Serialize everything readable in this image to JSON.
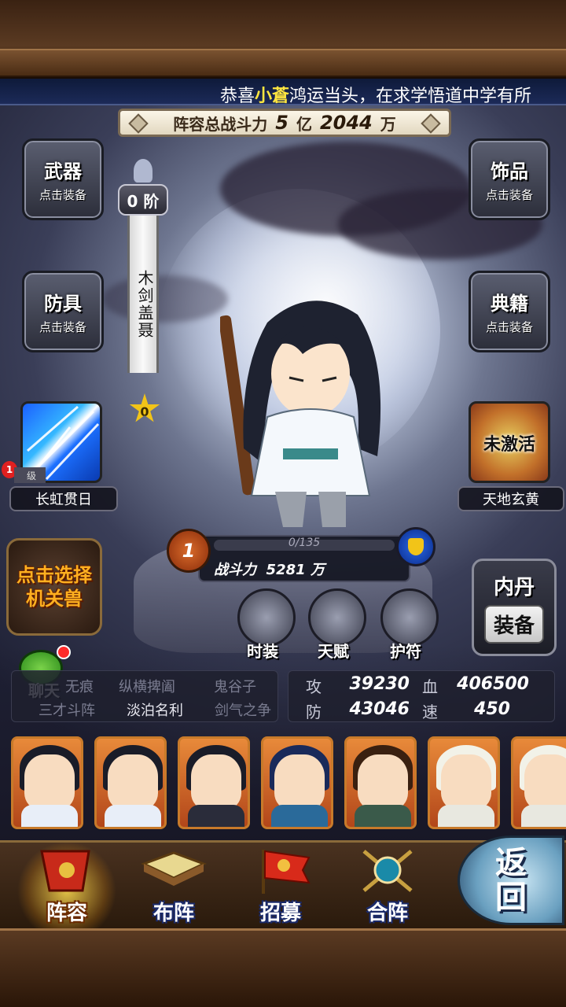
{
  "marquee": {
    "prefix": "恭喜",
    "name": "小蒼",
    "suffix": "鸿运当头，在求学悟道中学有所"
  },
  "power": {
    "label": "阵容总战斗力",
    "yi": "5",
    "yi_unit": "亿",
    "wan": "2044",
    "wan_unit": "万"
  },
  "equip": {
    "weapon": {
      "title": "武器",
      "sub": "点击装备"
    },
    "armor": {
      "title": "防具",
      "sub": "点击装备"
    },
    "accessory": {
      "title": "饰品",
      "sub": "点击装备"
    },
    "book": {
      "title": "典籍",
      "sub": "点击装备"
    }
  },
  "rank": {
    "stage": "0 阶",
    "hero_name": "木剑盖聂",
    "stars": "0"
  },
  "skills": {
    "left": {
      "name": "长虹贯日",
      "badge": "1",
      "tag": "级"
    },
    "right": {
      "name": "天地玄黄",
      "state": "未激活"
    }
  },
  "hero": {
    "level": "1",
    "exp_text": "0/135",
    "exp_fraction": 0,
    "power_label": "战斗力",
    "power_value": "5281",
    "power_unit": "万"
  },
  "actions": {
    "costume": "时装",
    "talent": "天赋",
    "charm": "护符"
  },
  "neidan": {
    "title": "内丹",
    "button": "装备"
  },
  "beast": {
    "label": "点击选择机关兽"
  },
  "chat": {
    "label": "聊天"
  },
  "fates": {
    "row1": [
      "无痕",
      "纵横捭阖",
      "鬼谷子"
    ],
    "row2": [
      "三才斗阵",
      "淡泊名利",
      "剑气之争"
    ]
  },
  "attrs": {
    "atk_label": "攻",
    "atk": "39230",
    "hp_label": "血",
    "hp": "406500",
    "def_label": "防",
    "def": "43046",
    "spd_label": "速",
    "spd": "450"
  },
  "tabs": {
    "lineup": "阵容",
    "formation": "布阵",
    "recruit": "招募",
    "combine": "合阵"
  },
  "back": {
    "label": "返回"
  }
}
